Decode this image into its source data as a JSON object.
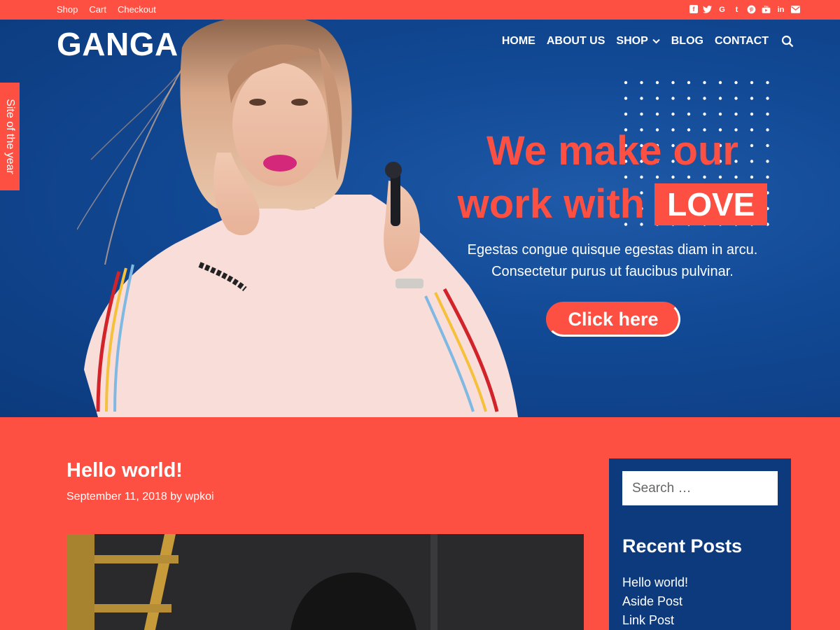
{
  "topbar": {
    "links": [
      "Shop",
      "Cart",
      "Checkout"
    ],
    "social_icons": [
      "facebook-icon",
      "twitter-icon",
      "google-icon",
      "tumblr-icon",
      "pinterest-icon",
      "youtube-icon",
      "linkedin-icon",
      "email-icon"
    ]
  },
  "header": {
    "logo": "GANGA",
    "nav": {
      "home": "HOME",
      "about": "ABOUT US",
      "shop": "SHOP",
      "blog": "BLOG",
      "contact": "CONTACT"
    }
  },
  "side_tab": "Site of the year",
  "hero": {
    "line1": "We make our",
    "line2": "work with",
    "highlight": "LOVE",
    "sub1": "Egestas congue quisque egestas diam in arcu.",
    "sub2": "Consectetur purus ut faucibus pulvinar.",
    "cta": "Click here"
  },
  "post": {
    "title": "Hello world!",
    "date": "September 11, 2018",
    "by": "by",
    "author": "wpkoi"
  },
  "sidebar": {
    "search_placeholder": "Search …",
    "widget_title": "Recent Posts",
    "recent_posts": [
      "Hello world!",
      "Aside Post",
      "Link Post"
    ]
  },
  "colors": {
    "accent": "#fd5042",
    "navy": "#0c3a7d",
    "hero_blue": "#124a96"
  }
}
